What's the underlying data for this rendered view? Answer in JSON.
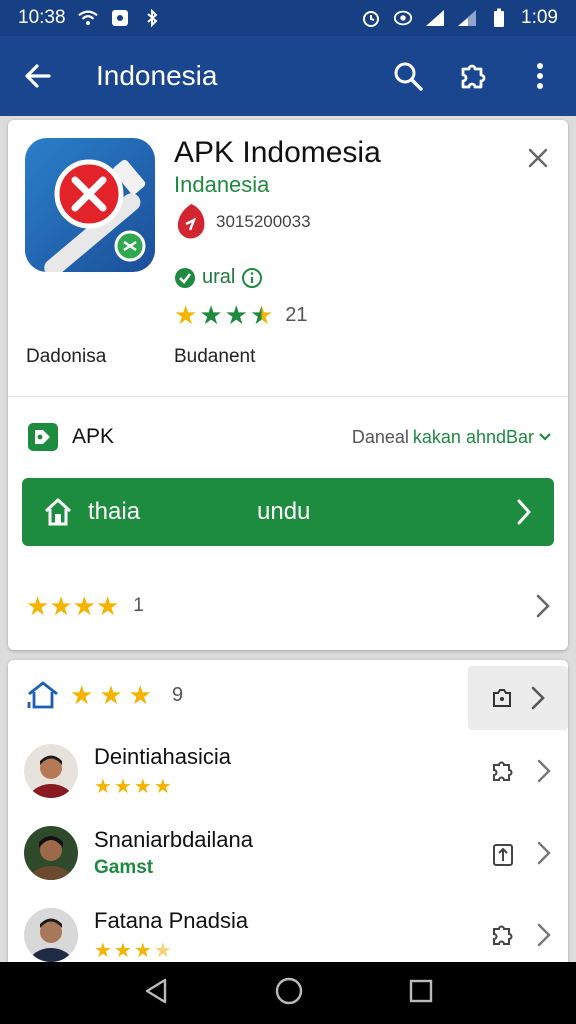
{
  "status_bar": {
    "time_left": "10:38",
    "time_right": "1:09"
  },
  "app_bar": {
    "title": "Indonesia"
  },
  "app": {
    "name": "APK Indomesia",
    "developer": "Indanesia",
    "id_number": "3015200033",
    "version_label": "ural",
    "rating_count": "21",
    "meta_left": "Dadonisa",
    "meta_right": "Budanent"
  },
  "apk_row": {
    "label": "APK",
    "link_prefix": "Daneal",
    "link_text": "kakan ahndBar"
  },
  "download_button": {
    "left_label": "thaia",
    "center_label": "undu"
  },
  "card_rating": {
    "count": "1",
    "stars": 4
  },
  "reviews_header": {
    "count": "9",
    "stars": 3
  },
  "reviews": [
    {
      "name": "Deintiahasicia",
      "badge": "",
      "stars": 4
    },
    {
      "name": "Snaniarbdailana",
      "badge": "Gamst",
      "stars": 0
    },
    {
      "name": "Fatana Pnadsia",
      "badge": "",
      "stars": 3.5
    }
  ],
  "colors": {
    "status_bar": "#173f84",
    "app_bar": "#1a4690",
    "accent_green": "#1e8c3e",
    "star_gold": "#f4b400",
    "star_green": "#1e8a3f"
  },
  "icons": {
    "back": "arrow-left-icon",
    "search": "search-icon",
    "puzzle": "puzzle-icon",
    "more": "more-vert-icon",
    "close": "close-icon",
    "download_home": "home-icon",
    "chevron": "chevron-right-icon"
  }
}
